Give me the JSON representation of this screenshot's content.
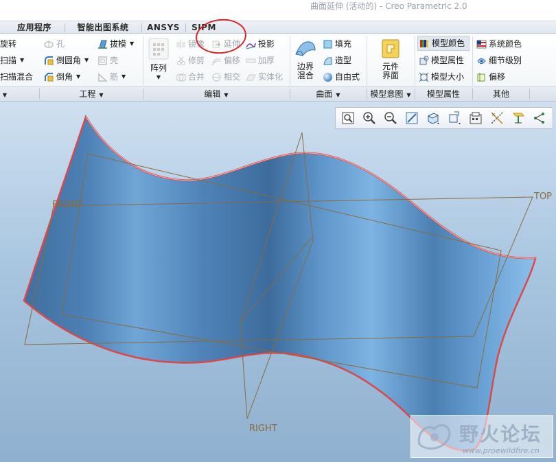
{
  "window": {
    "title": "曲面延伸 (活动的) - Creo Parametric 2.0"
  },
  "tabs": [
    {
      "label": "应用程序"
    },
    {
      "label": "智能出图系统"
    },
    {
      "label": "ANSYS"
    },
    {
      "label": "SIPM"
    }
  ],
  "ribbon": {
    "engineering": {
      "revolve": "旋转",
      "sweep": "扫描",
      "swept_blend": "扫描混合",
      "hole": "孔",
      "round": "倒圆角",
      "chamfer": "倒角",
      "draft": "拔模",
      "shell": "壳",
      "rib": "筋"
    },
    "editing": {
      "pattern": "阵列",
      "mirror": "镜像",
      "trim": "修剪",
      "merge": "合并",
      "extend": "延伸",
      "offset": "偏移",
      "intersect": "相交",
      "project": "投影",
      "thicken": "加厚",
      "solidify": "实体化"
    },
    "surfaces": {
      "boundary_blend_line1": "边界",
      "boundary_blend_line2": "混合",
      "fill": "填充",
      "style": "造型",
      "freestyle": "自由式"
    },
    "model_intent": {
      "component_interface_line1": "元件",
      "component_interface_line2": "界面"
    },
    "model_props": {
      "appearance": "模型颜色",
      "properties": "模型属性",
      "model_size": "模型大小"
    },
    "other": {
      "system_colors": "系统颜色",
      "detail_level": "细节级别",
      "offset": "偏移"
    }
  },
  "groups": [
    {
      "label": "工程"
    },
    {
      "label": "编辑"
    },
    {
      "label": "曲面"
    },
    {
      "label": "模型意图"
    },
    {
      "label": "模型属性"
    },
    {
      "label": "其他"
    }
  ],
  "view_toolbar": {
    "icons": [
      "refit-icon",
      "zoom-in-icon",
      "zoom-out-icon",
      "repaint-icon",
      "display-style-icon",
      "saved-views-icon",
      "view-manager-icon",
      "datum-display-icon",
      "spin-center-icon",
      "annotation-display-icon"
    ]
  },
  "scene": {
    "planes": {
      "front": "FRONT",
      "top": "TOP",
      "right": "RIGHT"
    },
    "surface_color": "#5b8fc4",
    "edge_color": "#d9484a",
    "datum_color": "#8b6a3d",
    "highlight_circle_color": "#d8262a"
  },
  "watermark": {
    "name": "野火论坛",
    "url": "www.proewildfire.cn"
  }
}
